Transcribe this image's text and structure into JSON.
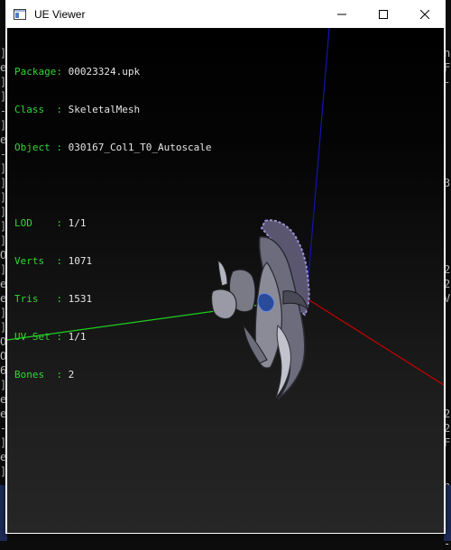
{
  "window": {
    "title": "UE Viewer",
    "controls": {
      "minimize": "minimize",
      "maximize": "maximize",
      "close": "close"
    }
  },
  "info": {
    "package_label": "Package:",
    "package_value": "00023324.upk",
    "class_label": "Class  :",
    "class_value": "SkeletalMesh",
    "object_label": "Object :",
    "object_value": "030167_Col1_T0_Autoscale",
    "lod_label": "LOD    :",
    "lod_value": "1/1",
    "verts_label": "Verts  :",
    "verts_value": "1071",
    "tris_label": "Tris   :",
    "tris_value": "1531",
    "uvset_label": "UV Set :",
    "uvset_value": "1/1",
    "bones_label": "Bones  :",
    "bones_value": "2"
  },
  "background_console": {
    "left_chars": [
      "]",
      "e",
      "]",
      "]",
      "-",
      "]",
      "e",
      "-",
      "]",
      "]",
      "]",
      "]",
      "]",
      "]",
      "O",
      "]",
      "e",
      "e",
      "]",
      "]",
      "O",
      "O",
      "6",
      "]",
      "e",
      "e",
      "-",
      "]",
      "e",
      "]"
    ],
    "right_chars": [
      "n",
      "F",
      "-",
      "",
      "",
      "",
      "",
      "",
      "",
      "3",
      "",
      "",
      "",
      "",
      "",
      "2",
      "2",
      "V",
      "",
      "",
      "",
      "",
      "",
      "",
      "",
      "2",
      "2",
      "F",
      "",
      "",
      "n",
      "F",
      "",
      "",
      "-"
    ]
  },
  "colors": {
    "axis_x": "#c80000",
    "axis_y": "#1fd01f",
    "axis_z": "#1414b4",
    "label_green": "#33d633"
  }
}
